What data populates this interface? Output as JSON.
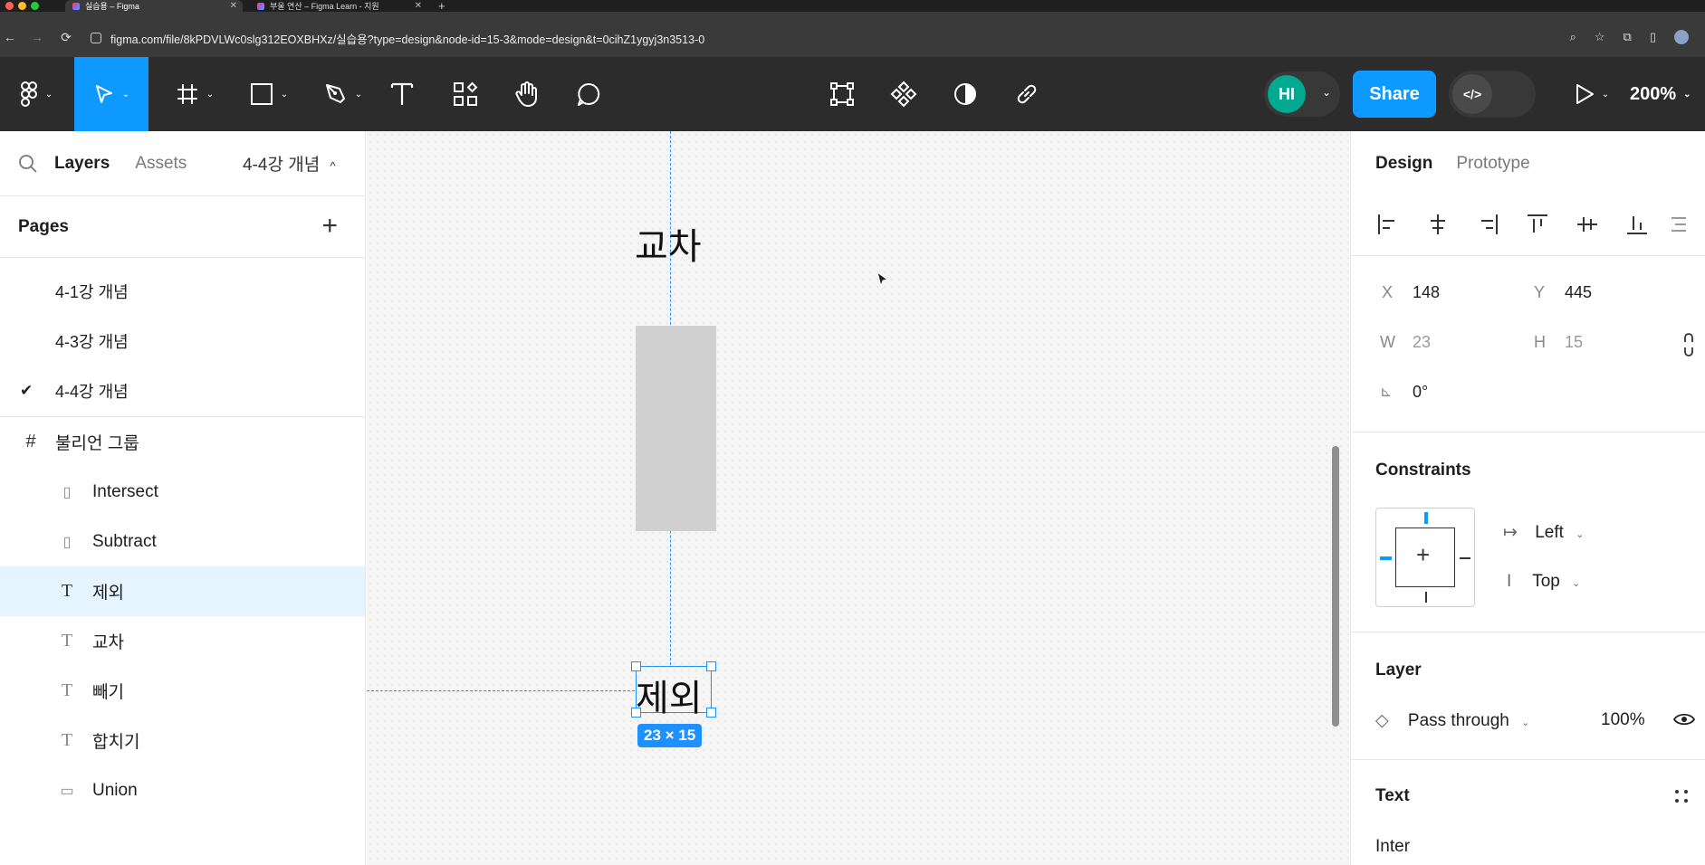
{
  "browser": {
    "tabs": [
      {
        "label": "실습용 – Figma",
        "active": true
      },
      {
        "label": "부울 연산 – Figma Learn - 지원",
        "active": false
      }
    ],
    "url": "figma.com/file/8kPDVLWc0slg312EOXBHXz/실습용?type=design&node-id=15-3&mode=design&t=0cihZ1ygyj3n3513-0"
  },
  "toolbar": {
    "avatar_initials": "HI",
    "share_label": "Share",
    "zoom_label": "200%",
    "icons": [
      "figma-menu-icon",
      "move-tool-icon",
      "frame-tool-icon",
      "shape-tool-icon",
      "pen-tool-icon",
      "text-tool-icon",
      "resources-icon",
      "hand-tool-icon",
      "comment-icon",
      "edit-object-icon",
      "component-icon",
      "mask-icon",
      "link-icon",
      "code-icon",
      "play-icon"
    ]
  },
  "left_panel": {
    "tabs": {
      "layers": "Layers",
      "assets": "Assets"
    },
    "current_page": "4-4강 개념",
    "pages_title": "Pages",
    "pages": [
      {
        "label": "4-1강 개념",
        "current": false
      },
      {
        "label": "4-3강 개념",
        "current": false
      },
      {
        "label": "4-4강 개념",
        "current": true
      }
    ],
    "layers": [
      {
        "label": "불리언 그룹",
        "icon": "frame-icon",
        "selected": false,
        "indent": 0
      },
      {
        "label": "Intersect",
        "icon": "rectangle-icon",
        "selected": false,
        "indent": 1
      },
      {
        "label": "Subtract",
        "icon": "rectangle-icon",
        "selected": false,
        "indent": 1
      },
      {
        "label": "제외",
        "icon": "text-icon",
        "selected": true,
        "indent": 1
      },
      {
        "label": "교차",
        "icon": "text-icon",
        "selected": false,
        "indent": 1
      },
      {
        "label": "빼기",
        "icon": "text-icon",
        "selected": false,
        "indent": 1
      },
      {
        "label": "합치기",
        "icon": "text-icon",
        "selected": false,
        "indent": 1
      },
      {
        "label": "Union",
        "icon": "rectangle-icon",
        "selected": false,
        "indent": 1
      }
    ]
  },
  "canvas": {
    "label_top": "교차",
    "label_selected": "제외",
    "dimensions": "23 × 15"
  },
  "right_panel": {
    "tabs": {
      "design": "Design",
      "prototype": "Prototype"
    },
    "x_label": "X",
    "x_value": "148",
    "y_label": "Y",
    "y_value": "445",
    "w_label": "W",
    "w_value": "23",
    "h_label": "H",
    "h_value": "15",
    "rotation": "0°",
    "constraints_title": "Constraints",
    "constraint_h": "Left",
    "constraint_v": "Top",
    "layer_title": "Layer",
    "blend_mode": "Pass through",
    "opacity": "100%",
    "text_title": "Text",
    "font_family": "Inter"
  },
  "colors": {
    "accent": "#0d99ff",
    "toolbar_bg": "#2c2c2c",
    "selection": "#e5f4ff"
  }
}
